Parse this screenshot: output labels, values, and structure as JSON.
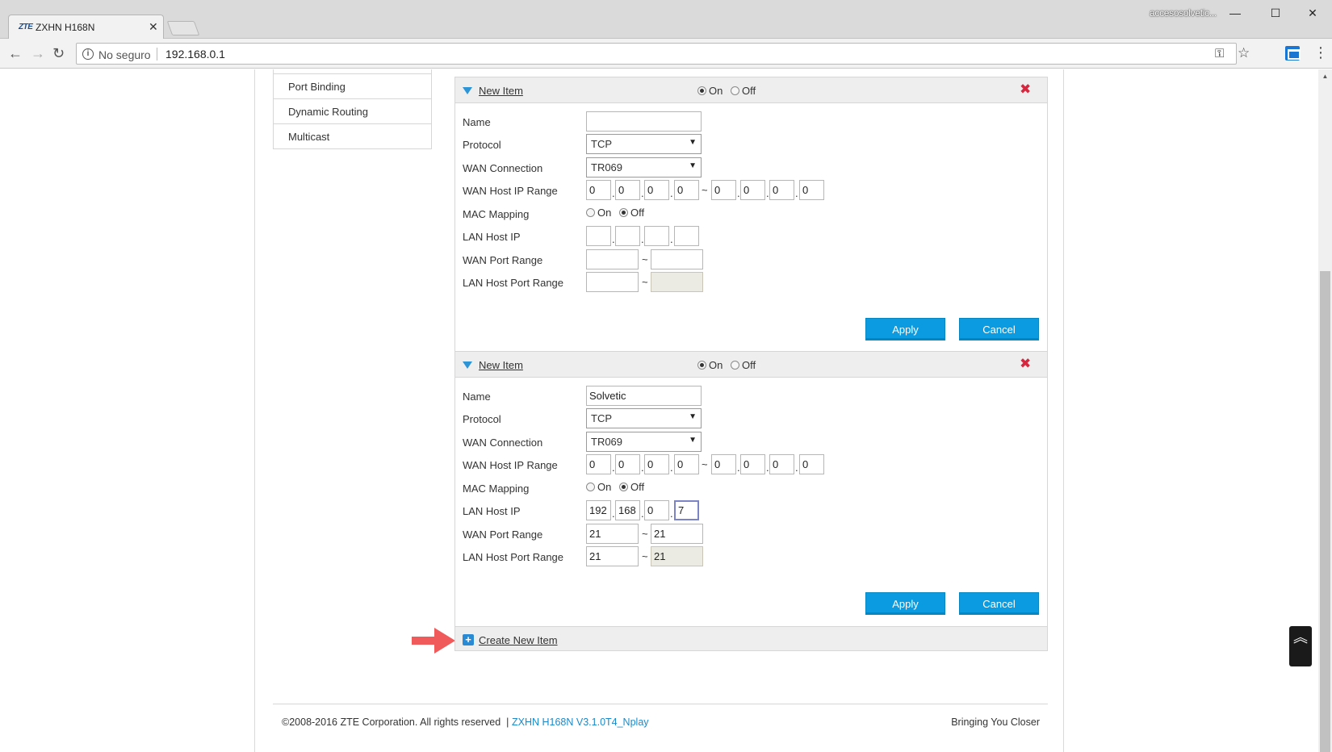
{
  "browser": {
    "tab_title": "ZXHN H168N",
    "tab_logo": "ZTE",
    "profile_name": "accesosolvetic...",
    "security_label": "No seguro",
    "url": "192.168.0.1"
  },
  "sidebar": {
    "items": [
      {
        "label": "Port Binding"
      },
      {
        "label": "Dynamic Routing"
      },
      {
        "label": "Multicast"
      }
    ]
  },
  "items": [
    {
      "title": "New Item",
      "enabled": "On",
      "on_label": "On",
      "off_label": "Off",
      "labels": {
        "name": "Name",
        "protocol": "Protocol",
        "wan_connection": "WAN Connection",
        "wan_host_ip_range": "WAN Host IP Range",
        "mac_mapping": "MAC Mapping",
        "lan_host_ip": "LAN Host IP",
        "wan_port_range": "WAN Port Range",
        "lan_host_port_range": "LAN Host Port Range"
      },
      "name": "",
      "protocol": "TCP",
      "wan_connection": "TR069",
      "wan_ip_start": [
        "0",
        "0",
        "0",
        "0"
      ],
      "wan_ip_end": [
        "0",
        "0",
        "0",
        "0"
      ],
      "mac_mapping": "Off",
      "lan_host_ip": [
        "",
        "",
        "",
        ""
      ],
      "wan_port_start": "",
      "wan_port_end": "",
      "lan_port_start": "",
      "lan_port_end": "",
      "apply_label": "Apply",
      "cancel_label": "Cancel"
    },
    {
      "title": "New Item",
      "enabled": "On",
      "on_label": "On",
      "off_label": "Off",
      "labels": {
        "name": "Name",
        "protocol": "Protocol",
        "wan_connection": "WAN Connection",
        "wan_host_ip_range": "WAN Host IP Range",
        "mac_mapping": "MAC Mapping",
        "lan_host_ip": "LAN Host IP",
        "wan_port_range": "WAN Port Range",
        "lan_host_port_range": "LAN Host Port Range"
      },
      "name": "Solvetic",
      "protocol": "TCP",
      "wan_connection": "TR069",
      "wan_ip_start": [
        "0",
        "0",
        "0",
        "0"
      ],
      "wan_ip_end": [
        "0",
        "0",
        "0",
        "0"
      ],
      "mac_mapping": "Off",
      "lan_host_ip": [
        "192",
        "168",
        "0",
        "7"
      ],
      "wan_port_start": "21",
      "wan_port_end": "21",
      "lan_port_start": "21",
      "lan_port_end": "21",
      "apply_label": "Apply",
      "cancel_label": "Cancel"
    }
  ],
  "create_new_label": "Create New Item",
  "footer": {
    "copyright": "©2008-2016 ZTE Corporation. All rights reserved",
    "separator": "|",
    "version": "ZXHN H168N V3.1.0T4_Nplay",
    "tagline": "Bringing You Closer"
  },
  "colors": {
    "accent_button": "#0a9be0",
    "delete_icon": "#d7263d",
    "link_blue": "#1c8ac9",
    "annotation_arrow": "#f05a5a"
  }
}
